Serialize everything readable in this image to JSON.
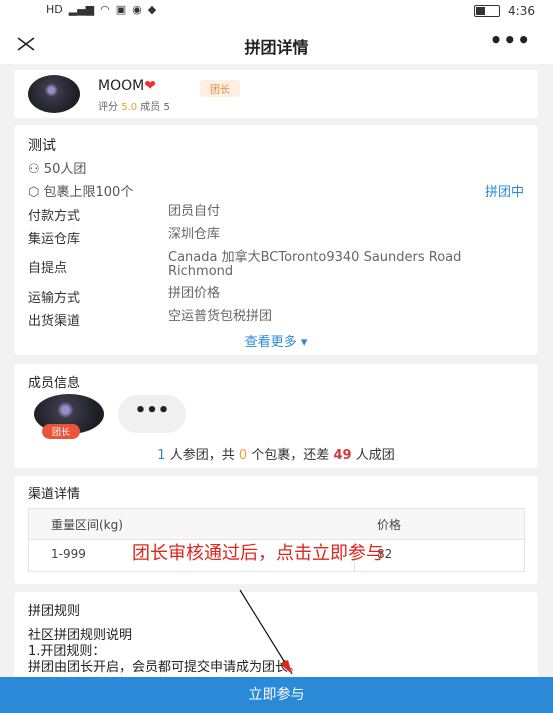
{
  "status_bar": {
    "time": "4:36"
  },
  "header": {
    "title": "拼团详情",
    "more": "•••"
  },
  "leader": {
    "name": "MOOM",
    "badge": "团长",
    "rating_label": "评分",
    "rating": "5.0",
    "members_label": "成员",
    "members": "5"
  },
  "group": {
    "name": "测试",
    "size_text": "50人团",
    "parcel_limit": "包裹上限100个",
    "status": "拼团中",
    "rows": [
      {
        "key": "付款方式",
        "value": "团员自付"
      },
      {
        "key": "集运仓库",
        "value": "深圳仓库"
      },
      {
        "key": "自提点",
        "value": "Canada 加拿大BCToronto9340 Saunders Road Richmond"
      },
      {
        "key": "运输方式",
        "value": "拼团价格"
      },
      {
        "key": "出货渠道",
        "value": "空运普货包税拼团"
      }
    ],
    "see_more": "查看更多"
  },
  "members": {
    "title": "成员信息",
    "badge": "团长",
    "more": "•••",
    "count": "1",
    "parcels": "0",
    "remaining": "49",
    "t1": "人参团，共",
    "t2": "个包裹，还差",
    "t3": "人成团"
  },
  "channel": {
    "title": "渠道详情",
    "col_weight": "重量区间(kg)",
    "col_price": "价格",
    "rows": [
      {
        "weight": "1-999",
        "price": "82"
      }
    ]
  },
  "rules": {
    "title": "拼团规则",
    "lines": [
      "社区拼团规则说明",
      "1.开团规则：",
      "拼团由团长开启，会员都可提交申请成为团长。"
    ]
  },
  "join_button": "立即参与",
  "annotation": {
    "text": "团长审核通过后，点击立即参与",
    "color": "#e0251b"
  },
  "colors": {
    "primary": "#2a8ad8",
    "accent": "#e8a23a",
    "danger": "#d23a3a"
  }
}
